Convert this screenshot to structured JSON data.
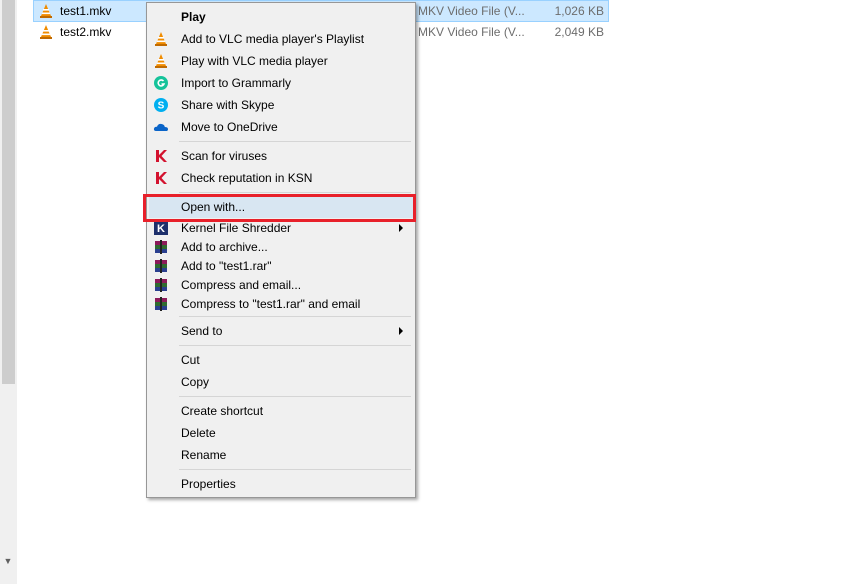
{
  "files": [
    {
      "name": "test1.mkv",
      "type": "MKV Video File (V...",
      "size": "1,026 KB",
      "icon": "vlc-cone-icon",
      "selected": true
    },
    {
      "name": "test2.mkv",
      "type": "MKV Video File (V...",
      "size": "2,049 KB",
      "icon": "vlc-cone-icon",
      "selected": false
    }
  ],
  "context_menu": {
    "play": "Play",
    "add_to_vlc_playlist": "Add to VLC media player's Playlist",
    "play_with_vlc": "Play with VLC media player",
    "import_grammarly": "Import to Grammarly",
    "share_skype": "Share with Skype",
    "move_onedrive": "Move to OneDrive",
    "scan_viruses": "Scan for viruses",
    "check_ksn": "Check reputation in KSN",
    "open_with": "Open with...",
    "kernel_shredder": "Kernel File Shredder",
    "add_archive": "Add to archive...",
    "add_rar": "Add to \"test1.rar\"",
    "compress_email": "Compress and email...",
    "compress_rar_email": "Compress to \"test1.rar\" and email",
    "send_to": "Send to",
    "cut": "Cut",
    "copy": "Copy",
    "create_shortcut": "Create shortcut",
    "delete": "Delete",
    "rename": "Rename",
    "properties": "Properties"
  },
  "colors": {
    "highlight_outline": "#e8202a",
    "selection": "#cce8ff",
    "vlc_orange": "#f08c00"
  }
}
